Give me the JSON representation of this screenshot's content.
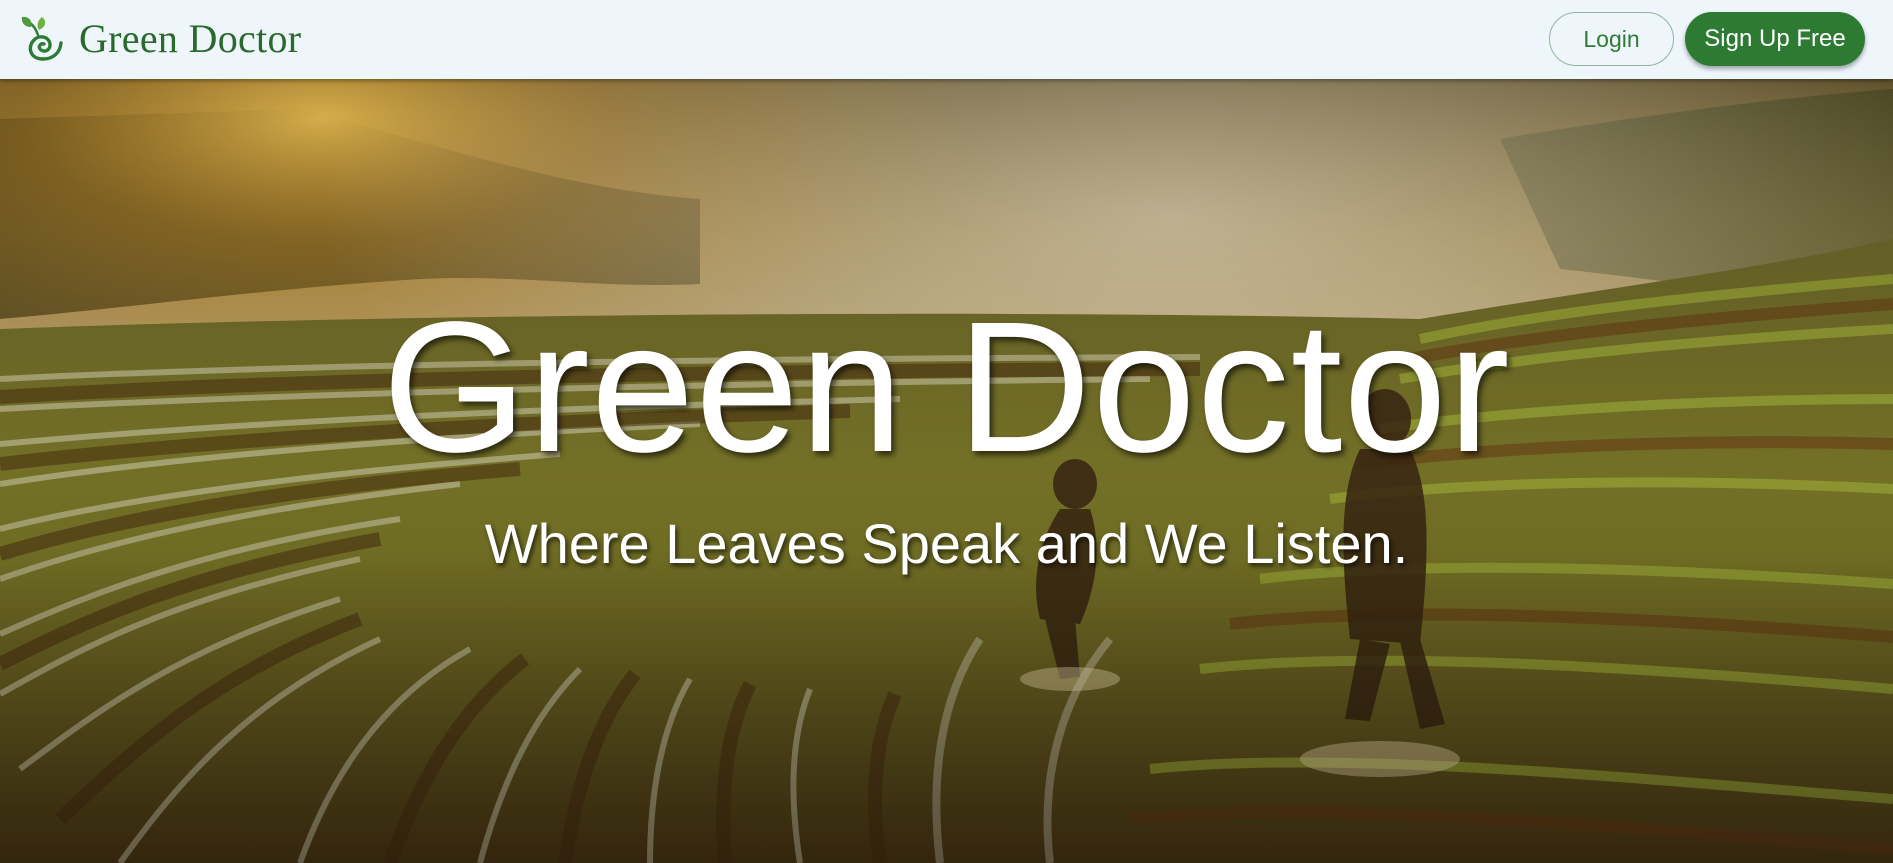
{
  "header": {
    "brand_name": "Green Doctor",
    "login_label": "Login",
    "signup_label": "Sign Up Free",
    "logo_icon": "sprout-leaf-icon"
  },
  "hero": {
    "title": "Green Doctor",
    "subtitle": "Where Leaves Speak and We Listen.",
    "background_image": "terraced-rice-field-photo"
  },
  "colors": {
    "nav_background": "#eef6fc",
    "brand_green": "#2a6b2d",
    "signup_button": "#2d7a33",
    "login_border": "#8fb69a",
    "hero_text": "#ffffff"
  }
}
